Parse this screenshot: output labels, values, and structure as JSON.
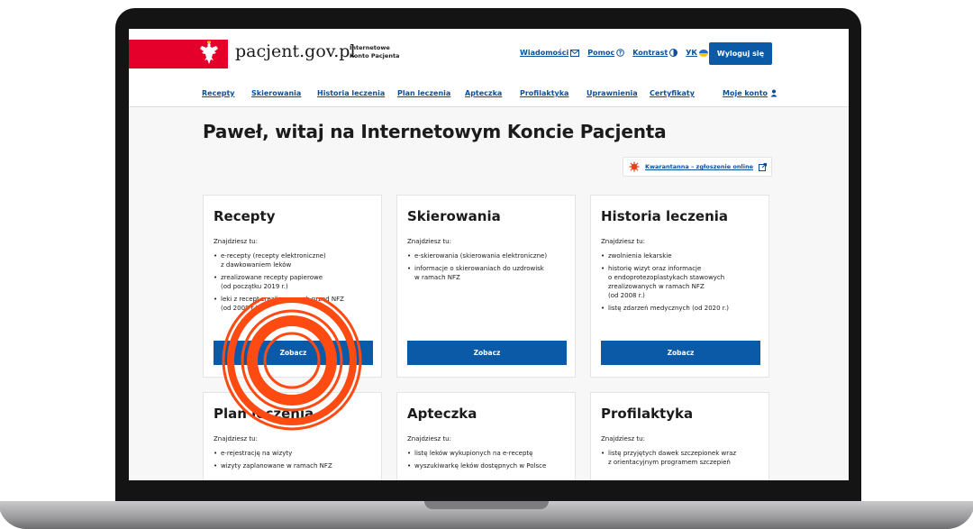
{
  "header": {
    "brand": "pacjent.gov.pl",
    "subtitle": "Internetowe\nKonto Pacjenta",
    "links": [
      {
        "label": "Wiadomości",
        "icon": "envelope-icon"
      },
      {
        "label": "Pomoc",
        "icon": "help-circle-icon"
      },
      {
        "label": "Kontrast",
        "icon": "contrast-icon"
      },
      {
        "label": "УК",
        "icon": "ukraine-flag-icon"
      }
    ],
    "logout_label": "Wyloguj się",
    "colors": {
      "flag_red": "#e4002b",
      "brand_blue": "#0b5aa8"
    }
  },
  "nav": {
    "items": [
      "Recepty",
      "Skierowania",
      "Historia leczenia",
      "Plan leczenia",
      "Apteczka",
      "Profilaktyka",
      "Uprawnienia",
      "Certyfikaty"
    ],
    "account": "Moje konto"
  },
  "main": {
    "heading": "Paweł, witaj na Internetowym Koncie Pacjenta",
    "quarantine_link": "Kwarantanna – zgłoszenie online"
  },
  "cards": [
    {
      "title": "Recepty",
      "subtitle": "Znajdziesz tu:",
      "items": [
        "e-recepty (recepty elektroniczne)\nz dawkowaniem leków",
        "zrealizowane recepty papierowe\n(od początku 2019 r.)",
        "leki z recept zrealizowanych przed NFZ\n(od 2008 r.)"
      ],
      "button": "Zobacz"
    },
    {
      "title": "Skierowania",
      "subtitle": "Znajdziesz tu:",
      "items": [
        "e-skierowania (skierowania elektroniczne)",
        "informacje o skierowaniach do uzdrowisk\nw ramach NFZ"
      ],
      "button": "Zobacz"
    },
    {
      "title": "Historia leczenia",
      "subtitle": "Znajdziesz tu:",
      "items": [
        "zwolnienia lekarskie",
        "historię wizyt oraz informacje\no endoprotezoplastykach stawowych\nzrealizowanych w ramach NFZ\n(od 2008 r.)",
        "listę zdarzeń medycznych (od 2020 r.)"
      ],
      "button": "Zobacz"
    },
    {
      "title": "Plan leczenia",
      "subtitle": "Znajdziesz tu:",
      "items": [
        "e-rejestrację na wizyty",
        "wizyty zaplanowane w ramach NFZ"
      ]
    },
    {
      "title": "Apteczka",
      "subtitle": "Znajdziesz tu:",
      "items": [
        "listę leków wykupionych na e-receptę",
        "wyszukiwarkę leków dostępnych w Polsce"
      ]
    },
    {
      "title": "Profilaktyka",
      "subtitle": "Znajdziesz tu:",
      "items": [
        "listę przyjętych dawek szczepionek wraz\nz orientacyjnym programem szczepień"
      ]
    }
  ],
  "overlay": {
    "icon": "orange-target-stamp-icon",
    "color": "#ff4a12"
  }
}
